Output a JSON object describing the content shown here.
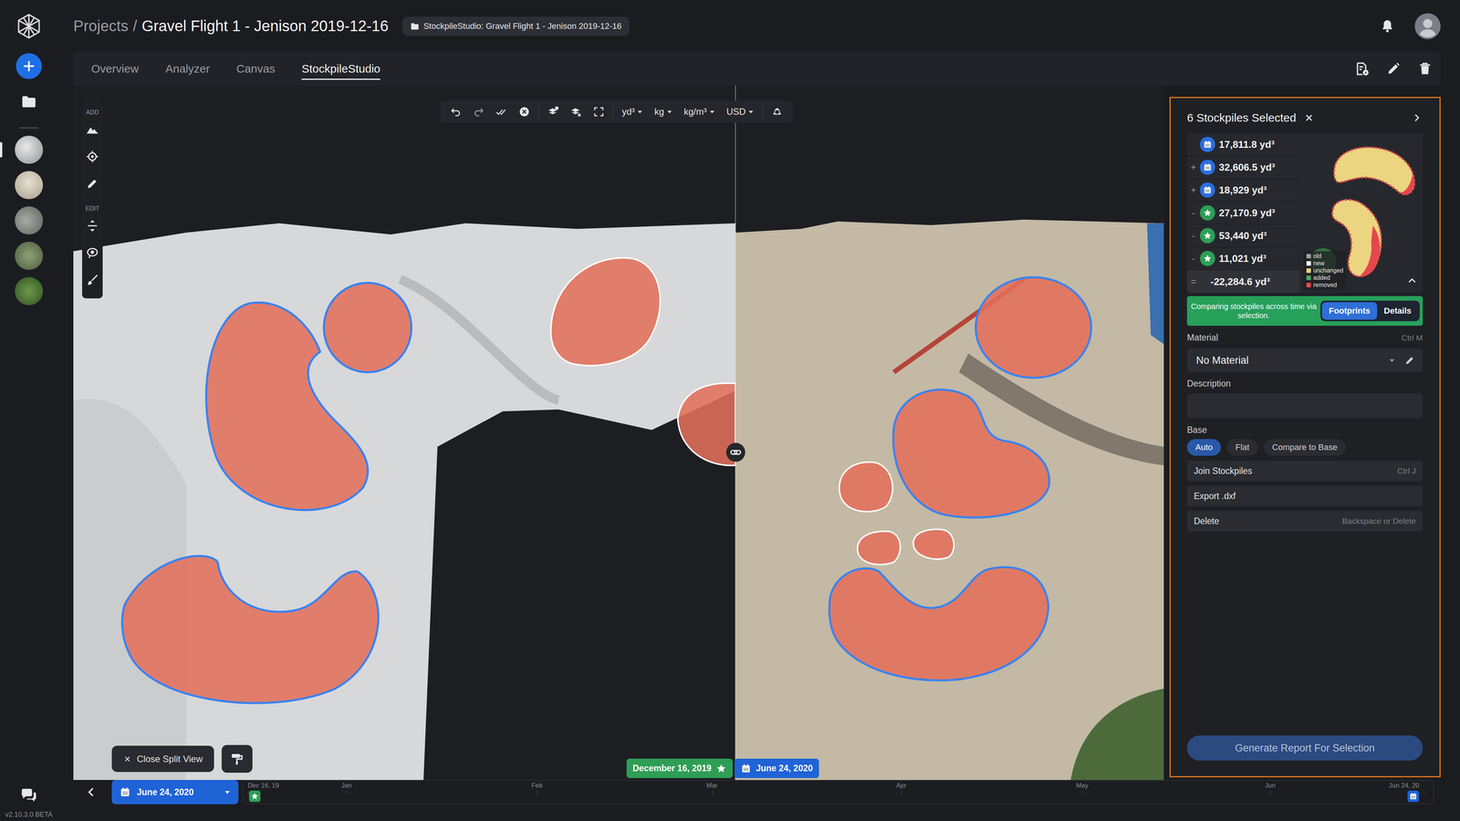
{
  "rail": {
    "items": [
      {
        "selected": true
      },
      {
        "selected": false
      },
      {
        "selected": false
      },
      {
        "selected": false
      },
      {
        "selected": false
      }
    ],
    "version": "v2.10.3.0 BETA"
  },
  "breadcrumb": {
    "root": "Projects",
    "separator": "/",
    "current": "Gravel Flight 1 - Jenison 2019-12-16"
  },
  "badge": "StockpileStudio: Gravel Flight 1 - Jenison 2019-12-16",
  "tabs": [
    {
      "label": "Overview",
      "selected": false
    },
    {
      "label": "Analyzer",
      "selected": false
    },
    {
      "label": "Canvas",
      "selected": false
    },
    {
      "label": "StockpileStudio",
      "selected": true
    }
  ],
  "toolbar": {
    "units": [
      "yd³",
      "kg",
      "kg/m³",
      "USD"
    ]
  },
  "tools": [
    {
      "label": "ADD"
    },
    {
      "label": "EDIT"
    }
  ],
  "map": {
    "stockpiles": [
      {
        "selected": true
      },
      {
        "selected": true
      },
      {
        "selected": false
      },
      {
        "selected": false
      },
      {
        "selected": true
      },
      {
        "selected": true
      },
      {
        "selected": true
      },
      {
        "selected": false
      },
      {
        "selected": false
      },
      {
        "selected": false
      },
      {
        "selected": true
      }
    ],
    "close_split": "Close Split View",
    "dates": [
      {
        "label": "December 16, 2019",
        "kind": "star",
        "color": "#2e9e55"
      },
      {
        "label": "June 24, 2020",
        "kind": "calendar",
        "color": "#1f63d6"
      }
    ]
  },
  "panel": {
    "title": "6 Stockpiles Selected",
    "volumes": [
      {
        "kind": "calendar",
        "value": "17,811.8 yd³"
      },
      {
        "sign": "+",
        "kind": "calendar",
        "value": "32,606.5 yd³"
      },
      {
        "sign": "+",
        "kind": "calendar",
        "value": "18,929 yd³"
      },
      {
        "sign": "-",
        "kind": "star",
        "value": "27,170.9 yd³"
      },
      {
        "sign": "-",
        "kind": "star",
        "value": "53,440 yd³"
      },
      {
        "sign": "-",
        "kind": "star",
        "value": "11,021 yd³"
      }
    ],
    "total": {
      "sign": "=",
      "value": "-22,284.6 yd³"
    },
    "legend": [
      {
        "label": "old",
        "color": "#9aa0a6"
      },
      {
        "label": "new",
        "color": "#ffffff"
      },
      {
        "label": "unchanged",
        "color": "#e8d27c"
      },
      {
        "label": "added",
        "color": "#3fae5a"
      },
      {
        "label": "removed",
        "color": "#e5484d"
      }
    ],
    "compare": {
      "text": "Comparing stockpiles across time via selection.",
      "modes": [
        {
          "label": "Footprints",
          "selected": true
        },
        {
          "label": "Details",
          "selected": false
        }
      ]
    },
    "material": {
      "label": "Material",
      "shortcut": "Ctrl M",
      "value": "No Material"
    },
    "description": {
      "label": "Description"
    },
    "base": {
      "label": "Base",
      "options": [
        {
          "label": "Auto",
          "selected": true
        },
        {
          "label": "Flat",
          "selected": false
        },
        {
          "label": "Compare to Base",
          "selected": false
        }
      ]
    },
    "actions": [
      {
        "label": "Join Stockpiles",
        "shortcut": "Ctrl J"
      },
      {
        "label": "Export .dxf"
      },
      {
        "label": "Delete",
        "shortcut": "Backspace or Delete"
      }
    ],
    "button": "Generate Report For Selection"
  },
  "timeline": {
    "current": "June 24, 2020",
    "ticks": [
      "Dec 16, 19",
      "Jan",
      "Feb",
      "Mar",
      "Apr",
      "May",
      "Jun",
      "Jun 24, 20"
    ]
  }
}
